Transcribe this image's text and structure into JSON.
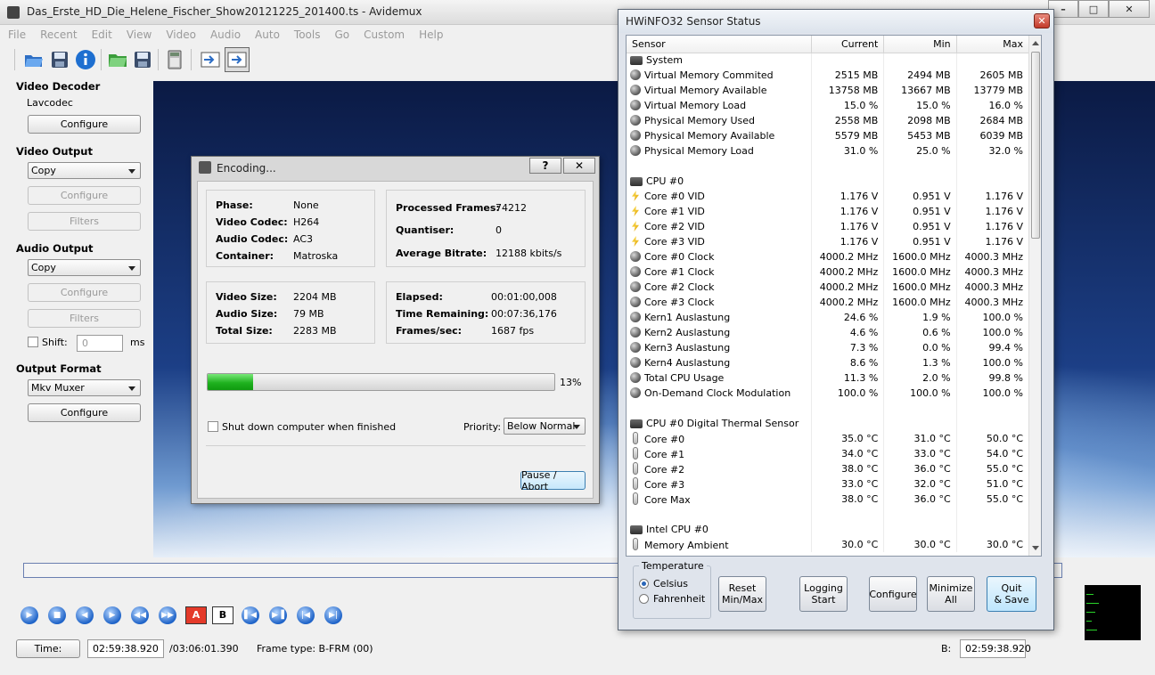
{
  "avidemux": {
    "title": "Das_Erste_HD_Die_Helene_Fischer_Show20121225_201400.ts - Avidemux",
    "menu": [
      "File",
      "Recent",
      "Edit",
      "View",
      "Video",
      "Audio",
      "Auto",
      "Tools",
      "Go",
      "Custom",
      "Help"
    ],
    "toolbar_icons": [
      "open-icon",
      "save-icon",
      "info-icon",
      "open-folder-icon",
      "save-as-icon",
      "calculator-icon",
      "export-icon",
      "export-active-icon"
    ],
    "video_decoder": {
      "heading": "Video Decoder",
      "codec": "Lavcodec",
      "configure": "Configure"
    },
    "video_output": {
      "heading": "Video Output",
      "selected": "Copy",
      "configure": "Configure",
      "filters": "Filters"
    },
    "audio_output": {
      "heading": "Audio Output",
      "selected": "Copy",
      "configure": "Configure",
      "filters": "Filters",
      "shift_label": "Shift:",
      "shift_value": "0",
      "shift_unit": "ms"
    },
    "output_format": {
      "heading": "Output Format",
      "selected": "Mkv Muxer",
      "configure": "Configure"
    },
    "controls": {
      "marker_a": "A",
      "marker_b": "B"
    },
    "status": {
      "time_button": "Time:",
      "time_value": "02:59:38.920",
      "duration": "/03:06:01.390",
      "frame_type": "Frame type:  B-FRM (00)",
      "b_label": "B:",
      "b_value": "02:59:38.920"
    }
  },
  "encoding": {
    "title": "Encoding...",
    "help": "?",
    "close": "✕",
    "phase_label": "Phase:",
    "phase": "None",
    "video_codec_label": "Video Codec:",
    "video_codec": "H264",
    "audio_codec_label": "Audio Codec:",
    "audio_codec": "AC3",
    "container_label": "Container:",
    "container": "Matroska",
    "processed_frames_label": "Processed Frames:",
    "processed_frames": "74212",
    "quantiser_label": "Quantiser:",
    "quantiser": "0",
    "avg_bitrate_label": "Average Bitrate:",
    "avg_bitrate": "12188 kbits/s",
    "video_size_label": "Video Size:",
    "video_size": "2204 MB",
    "audio_size_label": "Audio Size:",
    "audio_size": "79 MB",
    "total_size_label": "Total Size:",
    "total_size": "2283 MB",
    "elapsed_label": "Elapsed:",
    "elapsed": "00:01:00,008",
    "remaining_label": "Time Remaining:",
    "remaining": "00:07:36,176",
    "fps_label": "Frames/sec:",
    "fps": "1687 fps",
    "progress_percent": 13,
    "progress_text": "13%",
    "shutdown_label": "Shut down computer when finished",
    "priority_label": "Priority:",
    "priority": "Below Normal",
    "pause_abort": "Pause / Abort"
  },
  "hwinfo": {
    "title": "HWiNFO32 Sensor Status",
    "columns": [
      "Sensor",
      "Current",
      "Min",
      "Max"
    ],
    "groups": [
      {
        "name": "System",
        "rows": [
          {
            "icon": "disc",
            "name": "Virtual Memory Commited",
            "current": "2515 MB",
            "min": "2494 MB",
            "max": "2605 MB"
          },
          {
            "icon": "disc",
            "name": "Virtual Memory Available",
            "current": "13758 MB",
            "min": "13667 MB",
            "max": "13779 MB"
          },
          {
            "icon": "disc",
            "name": "Virtual Memory Load",
            "current": "15.0 %",
            "min": "15.0 %",
            "max": "16.0 %"
          },
          {
            "icon": "disc",
            "name": "Physical Memory Used",
            "current": "2558 MB",
            "min": "2098 MB",
            "max": "2684 MB"
          },
          {
            "icon": "disc",
            "name": "Physical Memory Available",
            "current": "5579 MB",
            "min": "5453 MB",
            "max": "6039 MB"
          },
          {
            "icon": "disc",
            "name": "Physical Memory Load",
            "current": "31.0 %",
            "min": "25.0 %",
            "max": "32.0 %"
          }
        ]
      },
      {
        "name": "CPU #0",
        "rows": [
          {
            "icon": "volt",
            "name": "Core #0 VID",
            "current": "1.176 V",
            "min": "0.951 V",
            "max": "1.176 V"
          },
          {
            "icon": "volt",
            "name": "Core #1 VID",
            "current": "1.176 V",
            "min": "0.951 V",
            "max": "1.176 V"
          },
          {
            "icon": "volt",
            "name": "Core #2 VID",
            "current": "1.176 V",
            "min": "0.951 V",
            "max": "1.176 V"
          },
          {
            "icon": "volt",
            "name": "Core #3 VID",
            "current": "1.176 V",
            "min": "0.951 V",
            "max": "1.176 V"
          },
          {
            "icon": "disc",
            "name": "Core #0 Clock",
            "current": "4000.2 MHz",
            "min": "1600.0 MHz",
            "max": "4000.3 MHz"
          },
          {
            "icon": "disc",
            "name": "Core #1 Clock",
            "current": "4000.2 MHz",
            "min": "1600.0 MHz",
            "max": "4000.3 MHz"
          },
          {
            "icon": "disc",
            "name": "Core #2 Clock",
            "current": "4000.2 MHz",
            "min": "1600.0 MHz",
            "max": "4000.3 MHz"
          },
          {
            "icon": "disc",
            "name": "Core #3 Clock",
            "current": "4000.2 MHz",
            "min": "1600.0 MHz",
            "max": "4000.3 MHz"
          },
          {
            "icon": "disc",
            "name": "Kern1 Auslastung",
            "current": "24.6 %",
            "min": "1.9 %",
            "max": "100.0 %"
          },
          {
            "icon": "disc",
            "name": "Kern2 Auslastung",
            "current": "4.6 %",
            "min": "0.6 %",
            "max": "100.0 %"
          },
          {
            "icon": "disc",
            "name": "Kern3 Auslastung",
            "current": "7.3 %",
            "min": "0.0 %",
            "max": "99.4 %"
          },
          {
            "icon": "disc",
            "name": "Kern4 Auslastung",
            "current": "8.6 %",
            "min": "1.3 %",
            "max": "100.0 %"
          },
          {
            "icon": "disc",
            "name": "Total CPU Usage",
            "current": "11.3 %",
            "min": "2.0 %",
            "max": "99.8 %"
          },
          {
            "icon": "disc",
            "name": "On-Demand Clock Modulation",
            "current": "100.0 %",
            "min": "100.0 %",
            "max": "100.0 %"
          }
        ]
      },
      {
        "name": "CPU #0 Digital Thermal Sensor",
        "rows": [
          {
            "icon": "therm",
            "name": "Core #0",
            "current": "35.0 °C",
            "min": "31.0 °C",
            "max": "50.0 °C"
          },
          {
            "icon": "therm",
            "name": "Core #1",
            "current": "34.0 °C",
            "min": "33.0 °C",
            "max": "54.0 °C"
          },
          {
            "icon": "therm",
            "name": "Core #2",
            "current": "38.0 °C",
            "min": "36.0 °C",
            "max": "55.0 °C"
          },
          {
            "icon": "therm",
            "name": "Core #3",
            "current": "33.0 °C",
            "min": "32.0 °C",
            "max": "51.0 °C"
          },
          {
            "icon": "therm",
            "name": "Core Max",
            "current": "38.0 °C",
            "min": "36.0 °C",
            "max": "55.0 °C"
          }
        ]
      },
      {
        "name": "Intel CPU #0",
        "rows": [
          {
            "icon": "therm",
            "name": "Memory Ambient",
            "current": "30.0 °C",
            "min": "30.0 °C",
            "max": "30.0 °C"
          }
        ]
      }
    ],
    "temperature": {
      "legend": "Temperature",
      "celsius": "Celsius",
      "fahrenheit": "Fahrenheit",
      "selected": "Celsius"
    },
    "buttons": {
      "reset": "Reset\nMin/Max",
      "logging": "Logging\nStart",
      "configure": "Configure",
      "minimize": "Minimize\nAll",
      "quit": "Quit\n& Save"
    }
  }
}
